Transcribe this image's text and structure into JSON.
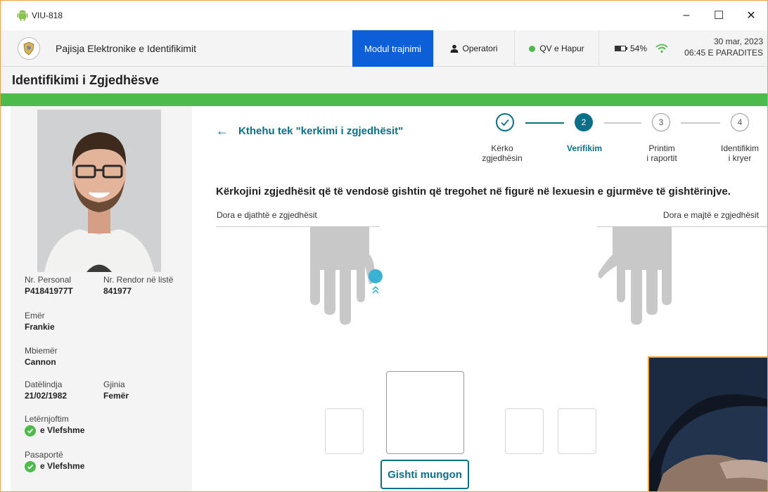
{
  "window": {
    "title": "VIU-818"
  },
  "header": {
    "device_name": "Pajisja Elektronike e Identifikimit",
    "mode_label": "Modul trajnimi",
    "operator_label": "Operatori",
    "qv_status": "QV e Hapur",
    "battery": "54%",
    "battery_level": 0.54,
    "date": "30 mar, 2023",
    "time": "06:45 E PARADITES"
  },
  "page": {
    "title": "Identifikimi i Zgjedhësve"
  },
  "voter": {
    "personal_no_label": "Nr. Personal",
    "personal_no": "P41841977T",
    "list_no_label": "Nr. Rendor në listë",
    "list_no": "841977",
    "first_name_label": "Emër",
    "first_name": "Frankie",
    "last_name_label": "Mbiemër",
    "last_name": "Cannon",
    "birth_label": "Datëlindja",
    "birth": "21/02/1982",
    "gender_label": "Gjinia",
    "gender": "Femër",
    "id_label": "Letërnjoftim",
    "id_status": "e Vlefshme",
    "passport_label": "Pasaportë",
    "passport_status": "e Vlefshme"
  },
  "main": {
    "back_label": "Kthehu tek \"kerkimi i zgjedhësit\"",
    "instruction": "Kërkojini zgjedhësit që të vendosë gishtin që tregohet në figurë në lexuesin e gjurmëve të gishtërinjve.",
    "right_hand_label": "Dora e djathtë e zgjedhësit",
    "left_hand_label": "Dora e majtë e zgjedhësit",
    "missing_finger_button": "Gishti mungon"
  },
  "stepper": {
    "steps": [
      {
        "number": "1",
        "label1": "Kërko",
        "label2": "zgjedhësin",
        "state": "done"
      },
      {
        "number": "2",
        "label1": "Verifikim",
        "label2": "",
        "state": "active"
      },
      {
        "number": "3",
        "label1": "Printim",
        "label2": "i raportit",
        "state": "pending"
      },
      {
        "number": "4",
        "label1": "Identifikim",
        "label2": "i kryer",
        "state": "pending"
      }
    ]
  },
  "colors": {
    "accent_teal": "#0b6f88",
    "mode_blue": "#0d5fd8",
    "status_green": "#4cbb4a",
    "finger_highlight": "#3ab2d6",
    "hand_gray": "#c8c8c8"
  }
}
